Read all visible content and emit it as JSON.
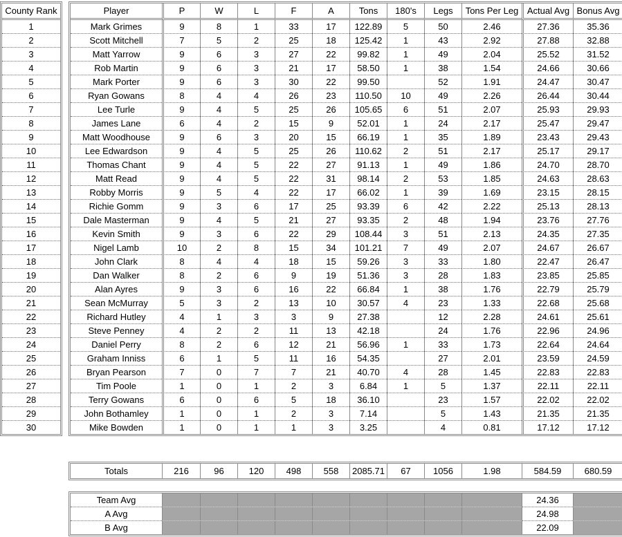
{
  "rank_table": {
    "header": "County Rank",
    "ranks": [
      "1",
      "2",
      "3",
      "4",
      "5",
      "6",
      "7",
      "8",
      "9",
      "10",
      "11",
      "12",
      "13",
      "14",
      "15",
      "16",
      "17",
      "18",
      "19",
      "20",
      "21",
      "22",
      "23",
      "24",
      "25",
      "26",
      "27",
      "28",
      "29",
      "30"
    ]
  },
  "main_table": {
    "headers": [
      "Player",
      "P",
      "W",
      "L",
      "F",
      "A",
      "Tons",
      "180's",
      "Legs",
      "Tons Per Leg",
      "Actual Avg",
      "Bonus Avg"
    ],
    "rows": [
      [
        "Mark Grimes",
        "9",
        "8",
        "1",
        "33",
        "17",
        "122.89",
        "5",
        "50",
        "2.46",
        "27.36",
        "35.36"
      ],
      [
        "Scott Mitchell",
        "7",
        "5",
        "2",
        "25",
        "18",
        "125.42",
        "1",
        "43",
        "2.92",
        "27.88",
        "32.88"
      ],
      [
        "Matt Yarrow",
        "9",
        "6",
        "3",
        "27",
        "22",
        "99.82",
        "1",
        "49",
        "2.04",
        "25.52",
        "31.52"
      ],
      [
        "Rob Martin",
        "9",
        "6",
        "3",
        "21",
        "17",
        "58.50",
        "1",
        "38",
        "1.54",
        "24.66",
        "30.66"
      ],
      [
        "Mark Porter",
        "9",
        "6",
        "3",
        "30",
        "22",
        "99.50",
        "",
        "52",
        "1.91",
        "24.47",
        "30.47"
      ],
      [
        "Ryan Gowans",
        "8",
        "4",
        "4",
        "26",
        "23",
        "110.50",
        "10",
        "49",
        "2.26",
        "26.44",
        "30.44"
      ],
      [
        "Lee Turle",
        "9",
        "4",
        "5",
        "25",
        "26",
        "105.65",
        "6",
        "51",
        "2.07",
        "25.93",
        "29.93"
      ],
      [
        "James Lane",
        "6",
        "4",
        "2",
        "15",
        "9",
        "52.01",
        "1",
        "24",
        "2.17",
        "25.47",
        "29.47"
      ],
      [
        "Matt Woodhouse",
        "9",
        "6",
        "3",
        "20",
        "15",
        "66.19",
        "1",
        "35",
        "1.89",
        "23.43",
        "29.43"
      ],
      [
        "Lee Edwardson",
        "9",
        "4",
        "5",
        "25",
        "26",
        "110.62",
        "2",
        "51",
        "2.17",
        "25.17",
        "29.17"
      ],
      [
        "Thomas Chant",
        "9",
        "4",
        "5",
        "22",
        "27",
        "91.13",
        "1",
        "49",
        "1.86",
        "24.70",
        "28.70"
      ],
      [
        "Matt Read",
        "9",
        "4",
        "5",
        "22",
        "31",
        "98.14",
        "2",
        "53",
        "1.85",
        "24.63",
        "28.63"
      ],
      [
        "Robby Morris",
        "9",
        "5",
        "4",
        "22",
        "17",
        "66.02",
        "1",
        "39",
        "1.69",
        "23.15",
        "28.15"
      ],
      [
        "Richie Gomm",
        "9",
        "3",
        "6",
        "17",
        "25",
        "93.39",
        "6",
        "42",
        "2.22",
        "25.13",
        "28.13"
      ],
      [
        "Dale Masterman",
        "9",
        "4",
        "5",
        "21",
        "27",
        "93.35",
        "2",
        "48",
        "1.94",
        "23.76",
        "27.76"
      ],
      [
        "Kevin Smith",
        "9",
        "3",
        "6",
        "22",
        "29",
        "108.44",
        "3",
        "51",
        "2.13",
        "24.35",
        "27.35"
      ],
      [
        "Nigel Lamb",
        "10",
        "2",
        "8",
        "15",
        "34",
        "101.21",
        "7",
        "49",
        "2.07",
        "24.67",
        "26.67"
      ],
      [
        "John Clark",
        "8",
        "4",
        "4",
        "18",
        "15",
        "59.26",
        "3",
        "33",
        "1.80",
        "22.47",
        "26.47"
      ],
      [
        "Dan Walker",
        "8",
        "2",
        "6",
        "9",
        "19",
        "51.36",
        "3",
        "28",
        "1.83",
        "23.85",
        "25.85"
      ],
      [
        "Alan Ayres",
        "9",
        "3",
        "6",
        "16",
        "22",
        "66.84",
        "1",
        "38",
        "1.76",
        "22.79",
        "25.79"
      ],
      [
        "Sean McMurray",
        "5",
        "3",
        "2",
        "13",
        "10",
        "30.57",
        "4",
        "23",
        "1.33",
        "22.68",
        "25.68"
      ],
      [
        "Richard Hutley",
        "4",
        "1",
        "3",
        "3",
        "9",
        "27.38",
        "",
        "12",
        "2.28",
        "24.61",
        "25.61"
      ],
      [
        "Steve Penney",
        "4",
        "2",
        "2",
        "11",
        "13",
        "42.18",
        "",
        "24",
        "1.76",
        "22.96",
        "24.96"
      ],
      [
        "Daniel Perry",
        "8",
        "2",
        "6",
        "12",
        "21",
        "56.96",
        "1",
        "33",
        "1.73",
        "22.64",
        "24.64"
      ],
      [
        "Graham Inniss",
        "6",
        "1",
        "5",
        "11",
        "16",
        "54.35",
        "",
        "27",
        "2.01",
        "23.59",
        "24.59"
      ],
      [
        "Bryan Pearson",
        "7",
        "0",
        "7",
        "7",
        "21",
        "40.70",
        "4",
        "28",
        "1.45",
        "22.83",
        "22.83"
      ],
      [
        "Tim Poole",
        "1",
        "0",
        "1",
        "2",
        "3",
        "6.84",
        "1",
        "5",
        "1.37",
        "22.11",
        "22.11"
      ],
      [
        "Terry Gowans",
        "6",
        "0",
        "6",
        "5",
        "18",
        "36.10",
        "",
        "23",
        "1.57",
        "22.02",
        "22.02"
      ],
      [
        "John Bothamley",
        "1",
        "0",
        "1",
        "2",
        "3",
        "7.14",
        "",
        "5",
        "1.43",
        "21.35",
        "21.35"
      ],
      [
        "Mike Bowden",
        "1",
        "0",
        "1",
        "1",
        "3",
        "3.25",
        "",
        "4",
        "0.81",
        "17.12",
        "17.12"
      ]
    ]
  },
  "totals": [
    "Totals",
    "216",
    "96",
    "120",
    "498",
    "558",
    "2085.71",
    "67",
    "1056",
    "1.98",
    "584.59",
    "680.59"
  ],
  "averages": [
    {
      "label": "Team Avg",
      "actual_avg": "24.36"
    },
    {
      "label": "A Avg",
      "actual_avg": "24.98"
    },
    {
      "label": "B Avg",
      "actual_avg": "22.09"
    }
  ],
  "colors": {
    "border": "#8a8a8a",
    "shaded_cell": "#a6a6a6"
  }
}
